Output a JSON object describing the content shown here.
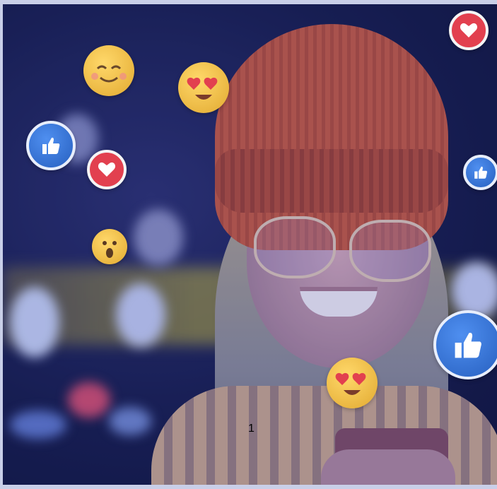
{
  "image": {
    "page_number": "1",
    "colors": {
      "hat": "#c65a3e",
      "heart": "#e2404f",
      "like": "#3474d9",
      "emoji": "#f2c14e",
      "background": "#141a45"
    },
    "icons": [
      "smiling-emoji-icon",
      "heart-eyes-emoji-icon",
      "heart-reaction-icon",
      "like-reaction-icon",
      "surprised-emoji-icon"
    ]
  }
}
